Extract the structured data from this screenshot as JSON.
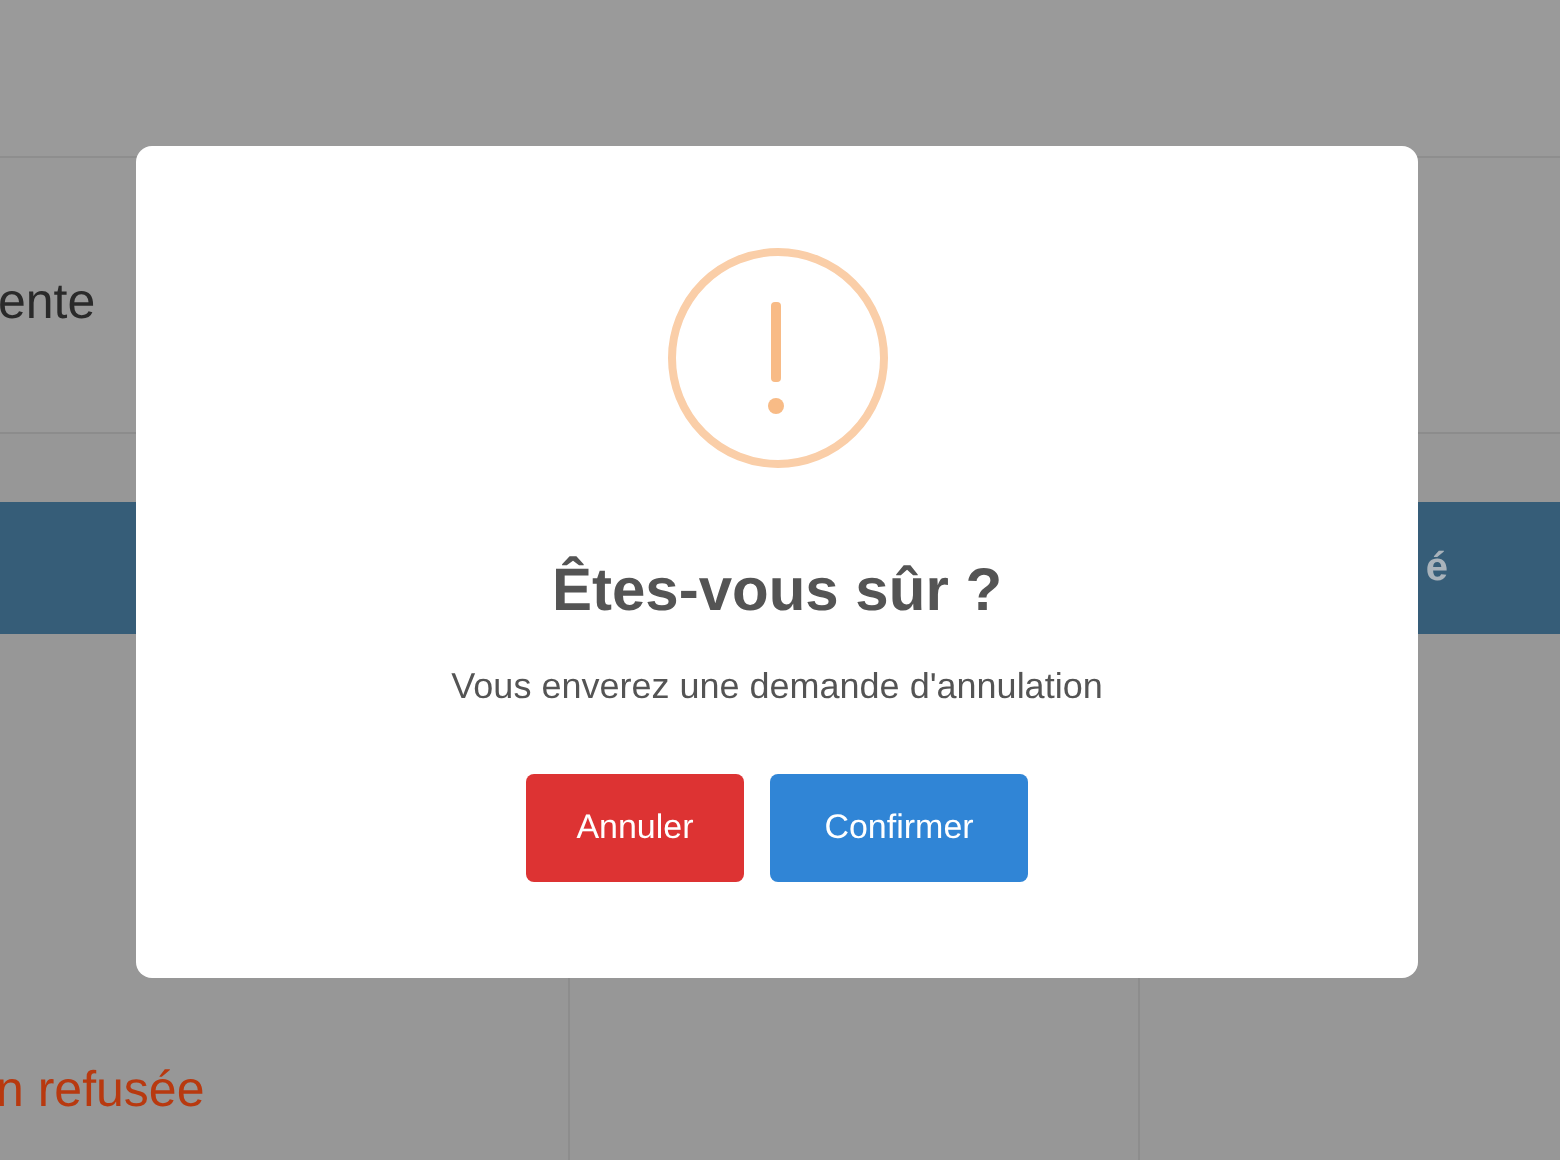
{
  "page": {
    "heading": "ente",
    "table_header": "é",
    "status_cell": "n refusée"
  },
  "dialog": {
    "title": "Êtes-vous sûr ?",
    "message": "Vous enverez une demande d'annulation",
    "buttons": [
      {
        "label": "Annuler",
        "kind": "cancel"
      },
      {
        "label": "Confirmer",
        "kind": "confirm"
      }
    ]
  }
}
